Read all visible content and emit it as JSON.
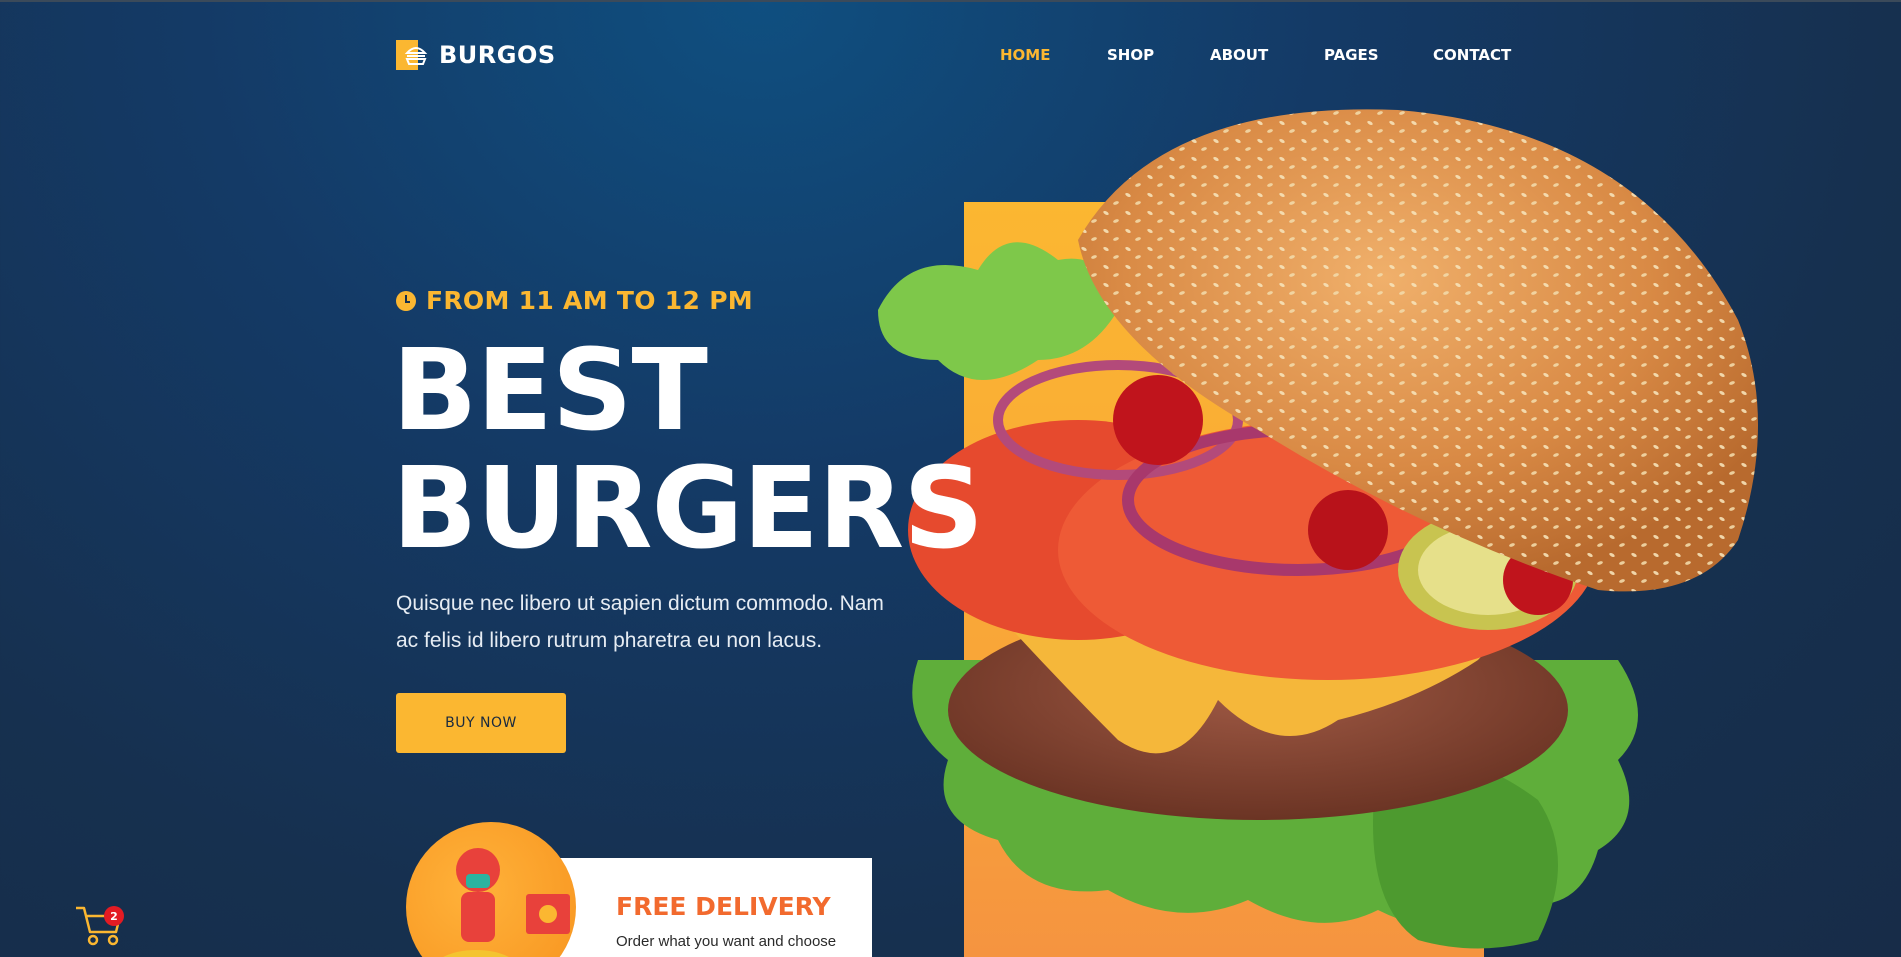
{
  "header": {
    "brand": "BURGOS",
    "nav": [
      {
        "label": "HOME",
        "active": true
      },
      {
        "label": "SHOP",
        "active": false
      },
      {
        "label": "ABOUT",
        "active": false
      },
      {
        "label": "PAGES",
        "active": false
      },
      {
        "label": "CONTACT",
        "active": false
      }
    ]
  },
  "hero": {
    "hours": "FROM 11 AM TO 12 PM",
    "headline_line1": "BEST",
    "headline_line2": "BURGERS",
    "description_line1": "Quisque nec libero ut sapien dictum commodo. Nam",
    "description_line2": "ac felis id libero rutrum pharetra eu non lacus.",
    "cta_label": "BUY NOW"
  },
  "delivery": {
    "title": "FREE DELIVERY",
    "subtitle": "Order what you want and choose"
  },
  "cart": {
    "count": "2"
  },
  "colors": {
    "accent": "#fbb731",
    "delivery_title": "#f26a2e",
    "badge": "#e31b23",
    "background": "#16304f"
  },
  "icons": [
    "burger-logo-icon",
    "clock-icon",
    "cart-icon",
    "delivery-rider-icon"
  ]
}
